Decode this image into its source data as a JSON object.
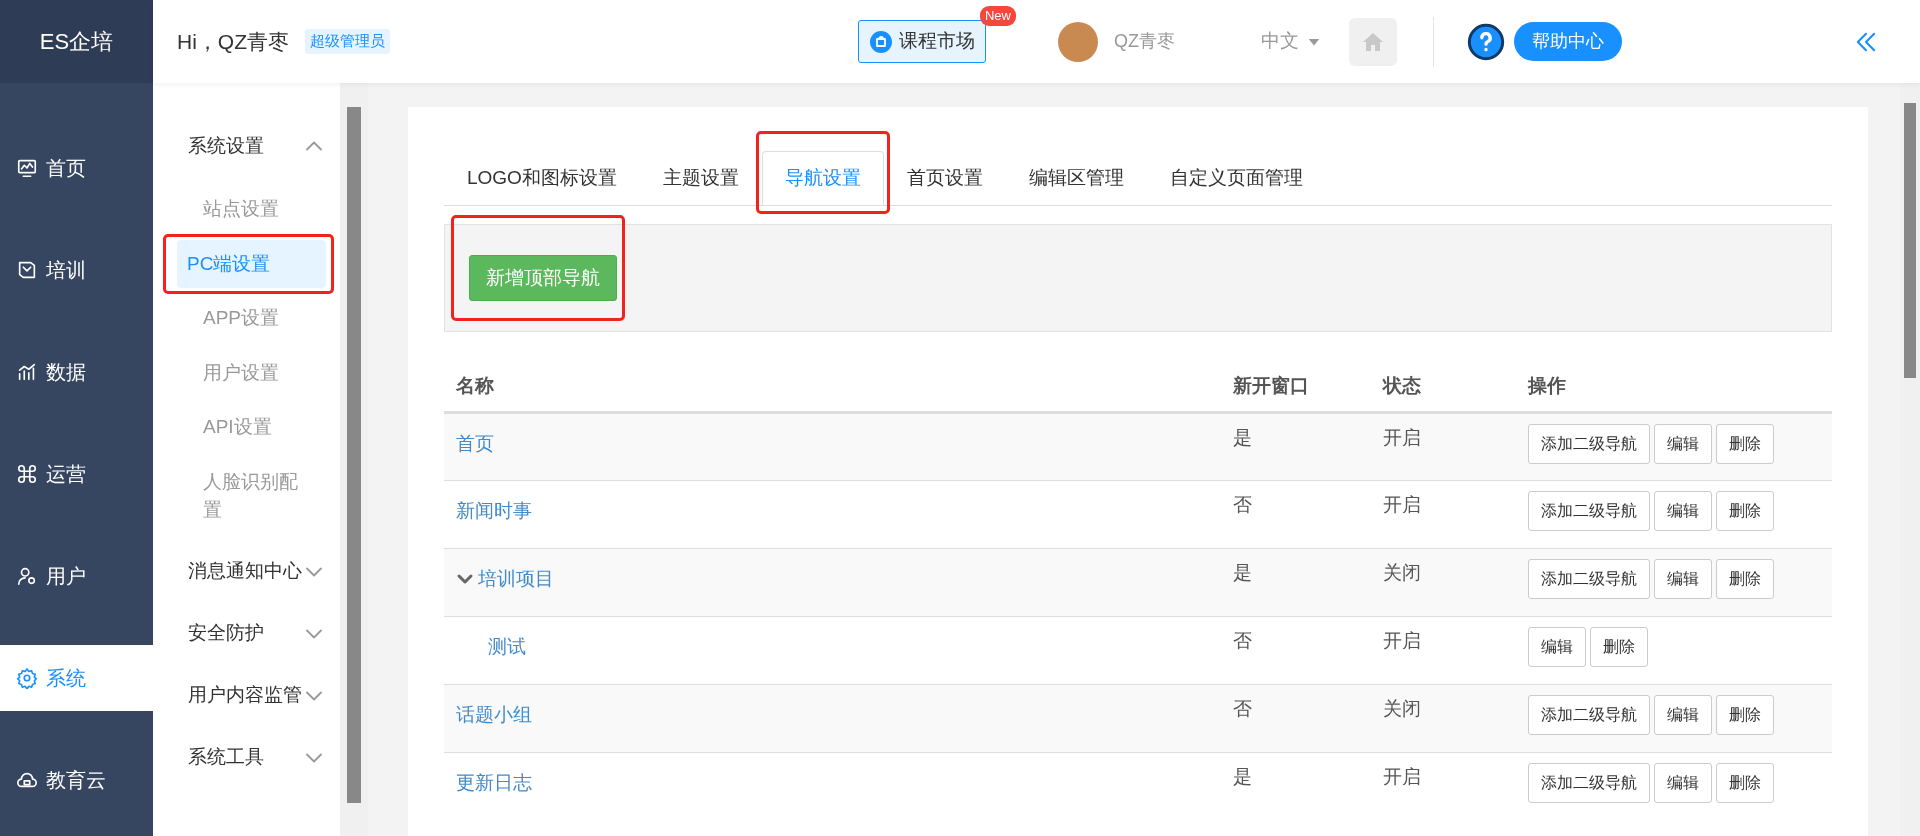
{
  "brand": "ES企培",
  "greeting": "Hi，QZ青枣",
  "role_badge": "超级管理员",
  "market": {
    "label": "课程市场",
    "badge": "New"
  },
  "user": {
    "name": "QZ青枣"
  },
  "language": "中文",
  "help": "帮助中心",
  "rail": [
    {
      "label": "首页",
      "selected": false
    },
    {
      "label": "培训",
      "selected": false
    },
    {
      "label": "数据",
      "selected": false
    },
    {
      "label": "运营",
      "selected": false
    },
    {
      "label": "用户",
      "selected": false
    },
    {
      "label": "系统",
      "selected": true
    },
    {
      "label": "教育云",
      "selected": false
    }
  ],
  "submenu": [
    {
      "label": "系统设置",
      "expanded": true,
      "children": [
        {
          "label": "站点设置",
          "selected": false,
          "highlighted": false
        },
        {
          "label": "PC端设置",
          "selected": true,
          "highlighted": true
        },
        {
          "label": "APP设置",
          "selected": false,
          "highlighted": false
        },
        {
          "label": "用户设置",
          "selected": false,
          "highlighted": false
        },
        {
          "label": "API设置",
          "selected": false,
          "highlighted": false
        },
        {
          "label": "人脸识别配置",
          "selected": false,
          "highlighted": false
        }
      ]
    },
    {
      "label": "消息通知中心",
      "expanded": false
    },
    {
      "label": "安全防护",
      "expanded": false
    },
    {
      "label": "用户内容监管",
      "expanded": false
    },
    {
      "label": "系统工具",
      "expanded": false
    }
  ],
  "tabs": [
    {
      "label": "LOGO和图标设置",
      "selected": false,
      "highlighted": false
    },
    {
      "label": "主题设置",
      "selected": false,
      "highlighted": false
    },
    {
      "label": "导航设置",
      "selected": true,
      "highlighted": true
    },
    {
      "label": "首页设置",
      "selected": false,
      "highlighted": false
    },
    {
      "label": "编辑区管理",
      "selected": false,
      "highlighted": false
    },
    {
      "label": "自定义页面管理",
      "selected": false,
      "highlighted": false
    }
  ],
  "add_button": {
    "label": "新增顶部导航",
    "highlighted": true
  },
  "table": {
    "columns": [
      "名称",
      "新开窗口",
      "状态",
      "操作"
    ],
    "rows": [
      {
        "name": "首页",
        "new_window": "是",
        "status": "开启",
        "actions": [
          "添加二级导航",
          "编辑",
          "删除"
        ]
      },
      {
        "name": "新闻时事",
        "new_window": "否",
        "status": "开启",
        "actions": [
          "添加二级导航",
          "编辑",
          "删除"
        ]
      },
      {
        "name": "培训项目",
        "new_window": "是",
        "status": "关闭",
        "actions": [
          "添加二级导航",
          "编辑",
          "删除"
        ],
        "expanded": true,
        "children": [
          {
            "name": "测试",
            "new_window": "否",
            "status": "开启",
            "actions": [
              "编辑",
              "删除"
            ]
          }
        ]
      },
      {
        "name": "话题小组",
        "new_window": "否",
        "status": "关闭",
        "actions": [
          "添加二级导航",
          "编辑",
          "删除"
        ]
      },
      {
        "name": "更新日志",
        "new_window": "是",
        "status": "开启",
        "actions": [
          "添加二级导航",
          "编辑",
          "删除"
        ]
      }
    ]
  }
}
